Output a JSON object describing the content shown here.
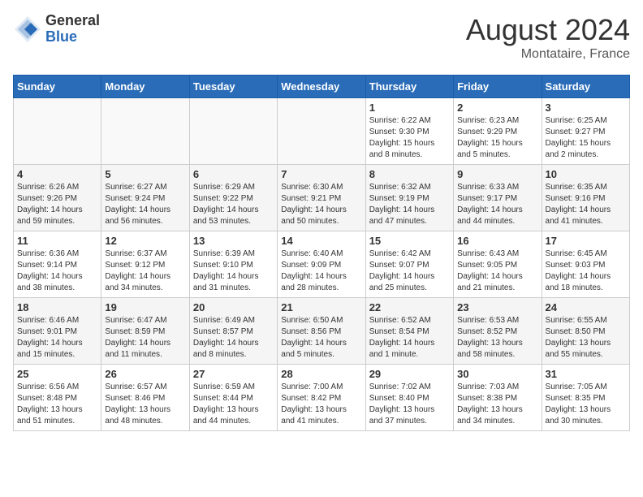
{
  "header": {
    "logo_general": "General",
    "logo_blue": "Blue",
    "month_year": "August 2024",
    "location": "Montataire, France"
  },
  "weekdays": [
    "Sunday",
    "Monday",
    "Tuesday",
    "Wednesday",
    "Thursday",
    "Friday",
    "Saturday"
  ],
  "weeks": [
    [
      {
        "day": "",
        "info": ""
      },
      {
        "day": "",
        "info": ""
      },
      {
        "day": "",
        "info": ""
      },
      {
        "day": "",
        "info": ""
      },
      {
        "day": "1",
        "info": "Sunrise: 6:22 AM\nSunset: 9:30 PM\nDaylight: 15 hours\nand 8 minutes."
      },
      {
        "day": "2",
        "info": "Sunrise: 6:23 AM\nSunset: 9:29 PM\nDaylight: 15 hours\nand 5 minutes."
      },
      {
        "day": "3",
        "info": "Sunrise: 6:25 AM\nSunset: 9:27 PM\nDaylight: 15 hours\nand 2 minutes."
      }
    ],
    [
      {
        "day": "4",
        "info": "Sunrise: 6:26 AM\nSunset: 9:26 PM\nDaylight: 14 hours\nand 59 minutes."
      },
      {
        "day": "5",
        "info": "Sunrise: 6:27 AM\nSunset: 9:24 PM\nDaylight: 14 hours\nand 56 minutes."
      },
      {
        "day": "6",
        "info": "Sunrise: 6:29 AM\nSunset: 9:22 PM\nDaylight: 14 hours\nand 53 minutes."
      },
      {
        "day": "7",
        "info": "Sunrise: 6:30 AM\nSunset: 9:21 PM\nDaylight: 14 hours\nand 50 minutes."
      },
      {
        "day": "8",
        "info": "Sunrise: 6:32 AM\nSunset: 9:19 PM\nDaylight: 14 hours\nand 47 minutes."
      },
      {
        "day": "9",
        "info": "Sunrise: 6:33 AM\nSunset: 9:17 PM\nDaylight: 14 hours\nand 44 minutes."
      },
      {
        "day": "10",
        "info": "Sunrise: 6:35 AM\nSunset: 9:16 PM\nDaylight: 14 hours\nand 41 minutes."
      }
    ],
    [
      {
        "day": "11",
        "info": "Sunrise: 6:36 AM\nSunset: 9:14 PM\nDaylight: 14 hours\nand 38 minutes."
      },
      {
        "day": "12",
        "info": "Sunrise: 6:37 AM\nSunset: 9:12 PM\nDaylight: 14 hours\nand 34 minutes."
      },
      {
        "day": "13",
        "info": "Sunrise: 6:39 AM\nSunset: 9:10 PM\nDaylight: 14 hours\nand 31 minutes."
      },
      {
        "day": "14",
        "info": "Sunrise: 6:40 AM\nSunset: 9:09 PM\nDaylight: 14 hours\nand 28 minutes."
      },
      {
        "day": "15",
        "info": "Sunrise: 6:42 AM\nSunset: 9:07 PM\nDaylight: 14 hours\nand 25 minutes."
      },
      {
        "day": "16",
        "info": "Sunrise: 6:43 AM\nSunset: 9:05 PM\nDaylight: 14 hours\nand 21 minutes."
      },
      {
        "day": "17",
        "info": "Sunrise: 6:45 AM\nSunset: 9:03 PM\nDaylight: 14 hours\nand 18 minutes."
      }
    ],
    [
      {
        "day": "18",
        "info": "Sunrise: 6:46 AM\nSunset: 9:01 PM\nDaylight: 14 hours\nand 15 minutes."
      },
      {
        "day": "19",
        "info": "Sunrise: 6:47 AM\nSunset: 8:59 PM\nDaylight: 14 hours\nand 11 minutes."
      },
      {
        "day": "20",
        "info": "Sunrise: 6:49 AM\nSunset: 8:57 PM\nDaylight: 14 hours\nand 8 minutes."
      },
      {
        "day": "21",
        "info": "Sunrise: 6:50 AM\nSunset: 8:56 PM\nDaylight: 14 hours\nand 5 minutes."
      },
      {
        "day": "22",
        "info": "Sunrise: 6:52 AM\nSunset: 8:54 PM\nDaylight: 14 hours\nand 1 minute."
      },
      {
        "day": "23",
        "info": "Sunrise: 6:53 AM\nSunset: 8:52 PM\nDaylight: 13 hours\nand 58 minutes."
      },
      {
        "day": "24",
        "info": "Sunrise: 6:55 AM\nSunset: 8:50 PM\nDaylight: 13 hours\nand 55 minutes."
      }
    ],
    [
      {
        "day": "25",
        "info": "Sunrise: 6:56 AM\nSunset: 8:48 PM\nDaylight: 13 hours\nand 51 minutes."
      },
      {
        "day": "26",
        "info": "Sunrise: 6:57 AM\nSunset: 8:46 PM\nDaylight: 13 hours\nand 48 minutes."
      },
      {
        "day": "27",
        "info": "Sunrise: 6:59 AM\nSunset: 8:44 PM\nDaylight: 13 hours\nand 44 minutes."
      },
      {
        "day": "28",
        "info": "Sunrise: 7:00 AM\nSunset: 8:42 PM\nDaylight: 13 hours\nand 41 minutes."
      },
      {
        "day": "29",
        "info": "Sunrise: 7:02 AM\nSunset: 8:40 PM\nDaylight: 13 hours\nand 37 minutes."
      },
      {
        "day": "30",
        "info": "Sunrise: 7:03 AM\nSunset: 8:38 PM\nDaylight: 13 hours\nand 34 minutes."
      },
      {
        "day": "31",
        "info": "Sunrise: 7:05 AM\nSunset: 8:35 PM\nDaylight: 13 hours\nand 30 minutes."
      }
    ]
  ]
}
